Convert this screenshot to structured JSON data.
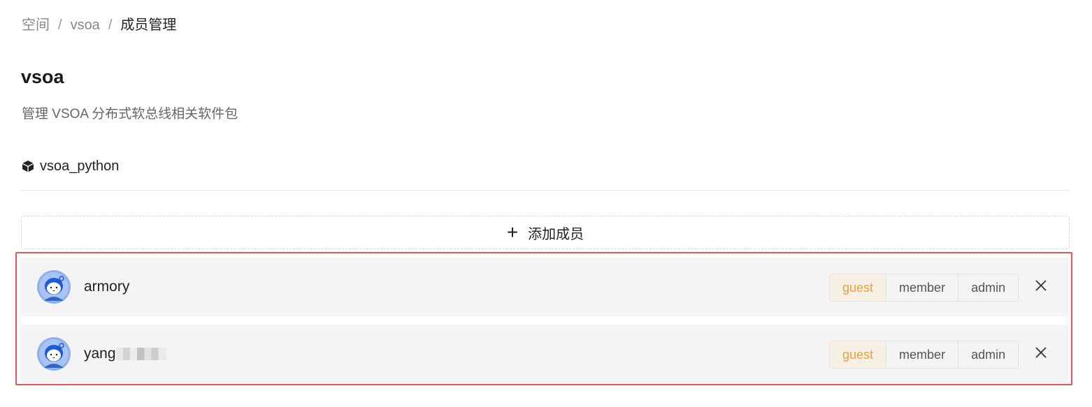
{
  "breadcrumb": {
    "items": [
      "空间",
      "vsoa",
      "成员管理"
    ],
    "separator": "/"
  },
  "space": {
    "title": "vsoa",
    "description": "管理 VSOA 分布式软总线相关软件包"
  },
  "package": {
    "icon": "package-cube-icon",
    "name": "vsoa_python"
  },
  "add_member": {
    "icon": "plus-icon",
    "label": "添加成员"
  },
  "members": [
    {
      "name": "armory",
      "avatar": "avatar-icon",
      "roles": [
        "guest",
        "member",
        "admin"
      ],
      "selected_role": "guest",
      "remove_icon": "close-icon"
    },
    {
      "name": "yang",
      "avatar": "avatar-icon",
      "roles": [
        "guest",
        "member",
        "admin"
      ],
      "selected_role": "guest",
      "remove_icon": "close-icon"
    }
  ],
  "colors": {
    "accent_role": "#e8a33d",
    "highlight_border": "#e05555",
    "card_bg": "#f4f4f4"
  }
}
